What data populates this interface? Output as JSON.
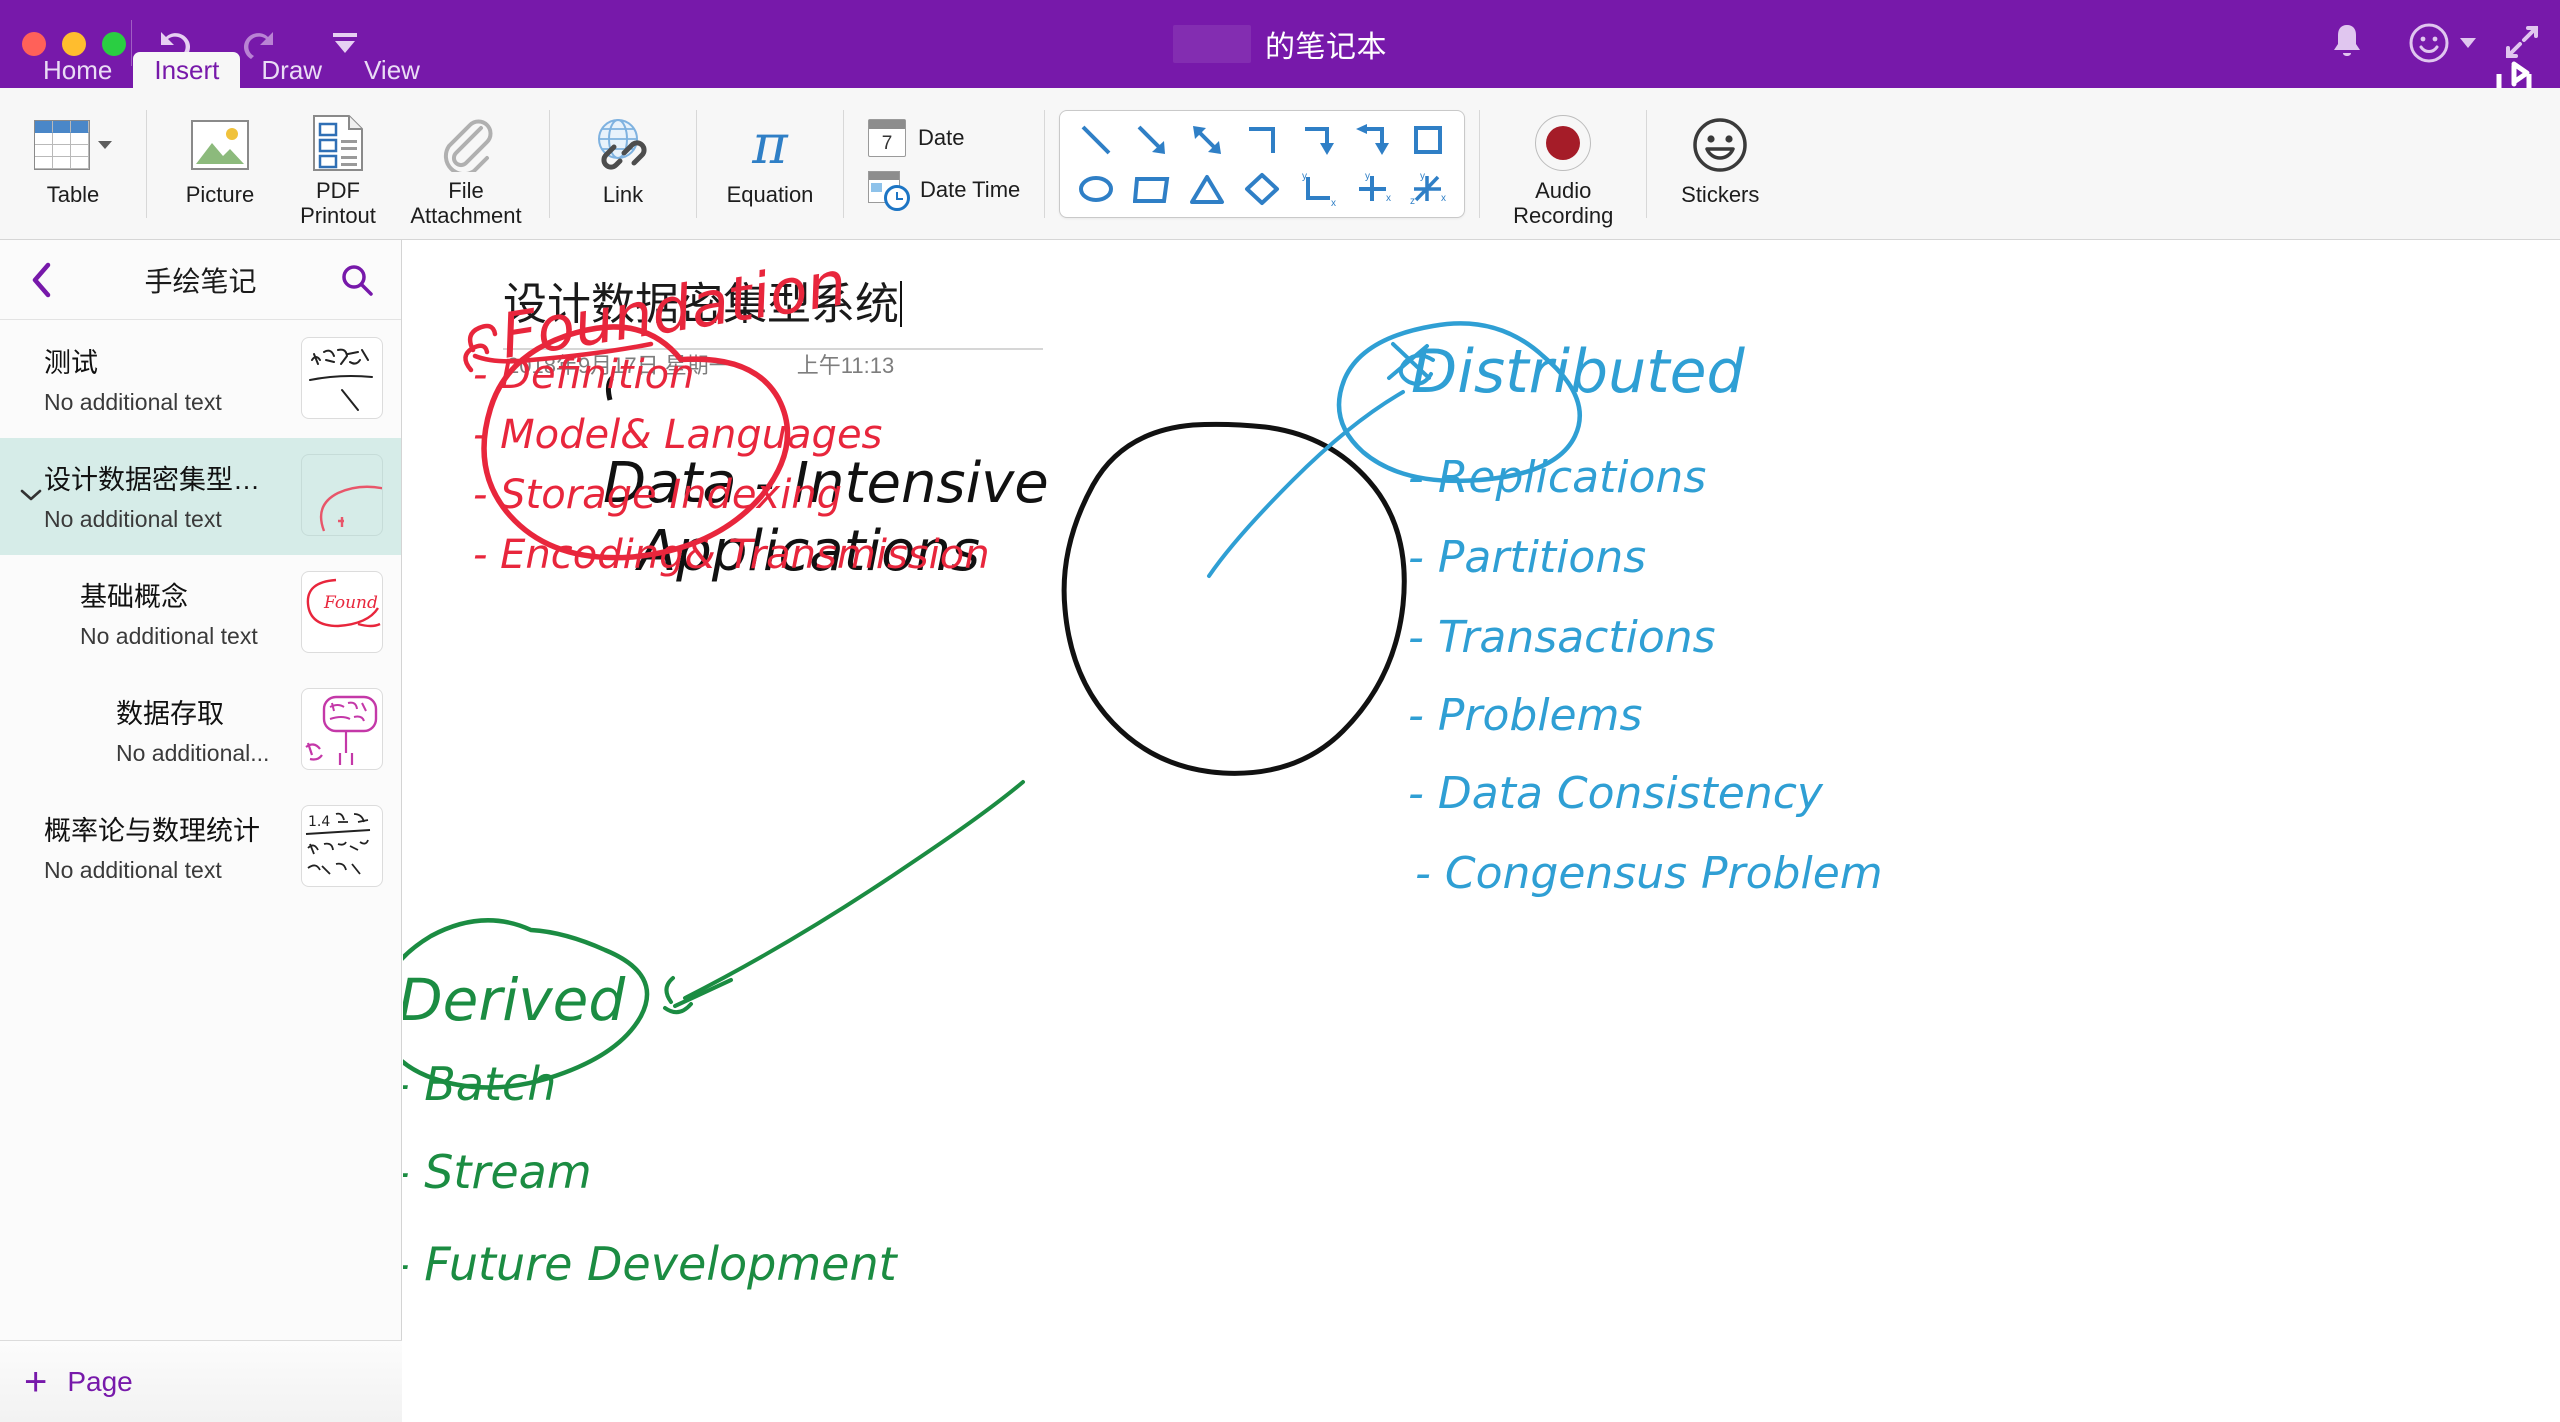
{
  "window": {
    "title": "的笔记本",
    "redacted_prefix": true,
    "accent_color": "#7719aa",
    "traffic_lights": [
      "close",
      "minimize",
      "maximize"
    ],
    "quick_actions": [
      {
        "name": "undo",
        "enabled": true
      },
      {
        "name": "redo",
        "enabled": false
      },
      {
        "name": "more-options",
        "enabled": true
      }
    ],
    "right_icons": [
      "bell-icon",
      "smiley-icon",
      "expand-icon",
      "share-icon"
    ]
  },
  "tabs": [
    {
      "label": "Home",
      "active": false
    },
    {
      "label": "Insert",
      "active": true
    },
    {
      "label": "Draw",
      "active": false
    },
    {
      "label": "View",
      "active": false
    }
  ],
  "ribbon": {
    "table": {
      "label": "Table",
      "icon": "table-icon",
      "has_dropdown": true
    },
    "picture": {
      "label": "Picture",
      "icon": "picture-icon"
    },
    "pdf_printout": {
      "label": "PDF\nPrintout",
      "line1": "PDF",
      "line2": "Printout",
      "icon": "pdf-icon"
    },
    "file_attachment": {
      "line1": "File",
      "line2": "Attachment",
      "icon": "paperclip-icon"
    },
    "link": {
      "label": "Link",
      "icon": "link-icon"
    },
    "equation": {
      "label": "Equation",
      "icon": "pi-icon"
    },
    "date": {
      "label": "Date",
      "icon": "calendar-icon",
      "day_number": "7"
    },
    "date_time": {
      "label": "Date  Time",
      "icon": "calendar-clock-icon"
    },
    "shapes": {
      "row1": [
        "line-diagonal",
        "arrow-diagonal-down",
        "arrow-double-diagonal",
        "elbow-connector",
        "elbow-arrow-down",
        "elbow-arrow-double",
        "square"
      ],
      "row2": [
        "ellipse",
        "parallelogram",
        "triangle",
        "diamond",
        "axes-xy-corner",
        "axes-cross-xy",
        "axes-xyz"
      ]
    },
    "audio_recording": {
      "line1": "Audio",
      "line2": "Recording",
      "icon": "record-icon"
    },
    "stickers": {
      "label": "Stickers",
      "icon": "smiley-outline-icon"
    }
  },
  "sidebar": {
    "title": "手绘笔记",
    "back_icon": "chevron-left-icon",
    "search_icon": "search-icon",
    "add_page_label": "Page",
    "add_icon": "plus-icon",
    "selected_bg": "#d6ece8",
    "items": [
      {
        "title": "测试",
        "subtitle": "No additional text",
        "indent": 0,
        "expandable": false,
        "selected": false,
        "thumb": "handwritten-chinese-thumb"
      },
      {
        "title": "设计数据密集型…",
        "subtitle": "No additional text",
        "indent": 0,
        "expandable": true,
        "expanded": true,
        "selected": true,
        "thumb": "red-ink-thumb"
      },
      {
        "title": "基础概念",
        "subtitle": "No additional text",
        "indent": 1,
        "expandable": false,
        "selected": false,
        "thumb": "foundation-thumb"
      },
      {
        "title": "数据存取",
        "subtitle": "No additional...",
        "indent": 2,
        "expandable": false,
        "selected": false,
        "thumb": "magenta-ink-thumb"
      },
      {
        "title": "概率论与数理统计",
        "subtitle": "No additional text",
        "indent": 0,
        "expandable": false,
        "selected": false,
        "thumb": "notes-thumb"
      }
    ]
  },
  "page": {
    "title": "设计数据密集型系统",
    "date": "2018年9月17日 星期一",
    "time": "上午11:13"
  },
  "ink_notes": {
    "colors": {
      "red": "#e8263c",
      "blue": "#2f9fd4",
      "green": "#1b8c42",
      "black": "#111111"
    },
    "center_node": {
      "line1": "Data - Intensive",
      "line2": "Applications",
      "color": "#111111"
    },
    "branches": [
      {
        "name": "foundation",
        "color": "#e8263c",
        "heading": "Foundation",
        "items": [
          "- Definition",
          "- Model& Languages",
          "- Storage  Indexing",
          "- Encoding& Transmission"
        ]
      },
      {
        "name": "distributed",
        "color": "#2f9fd4",
        "heading": "Distributed",
        "items": [
          "- Replications",
          "- Partitions",
          "- Transactions",
          "- Problems",
          "- Data Consistency",
          "- Congensus Problem"
        ]
      },
      {
        "name": "derived",
        "color": "#1b8c42",
        "heading": "Derived",
        "items": [
          "- Batch",
          "- Stream",
          "- Future Development"
        ]
      }
    ]
  }
}
